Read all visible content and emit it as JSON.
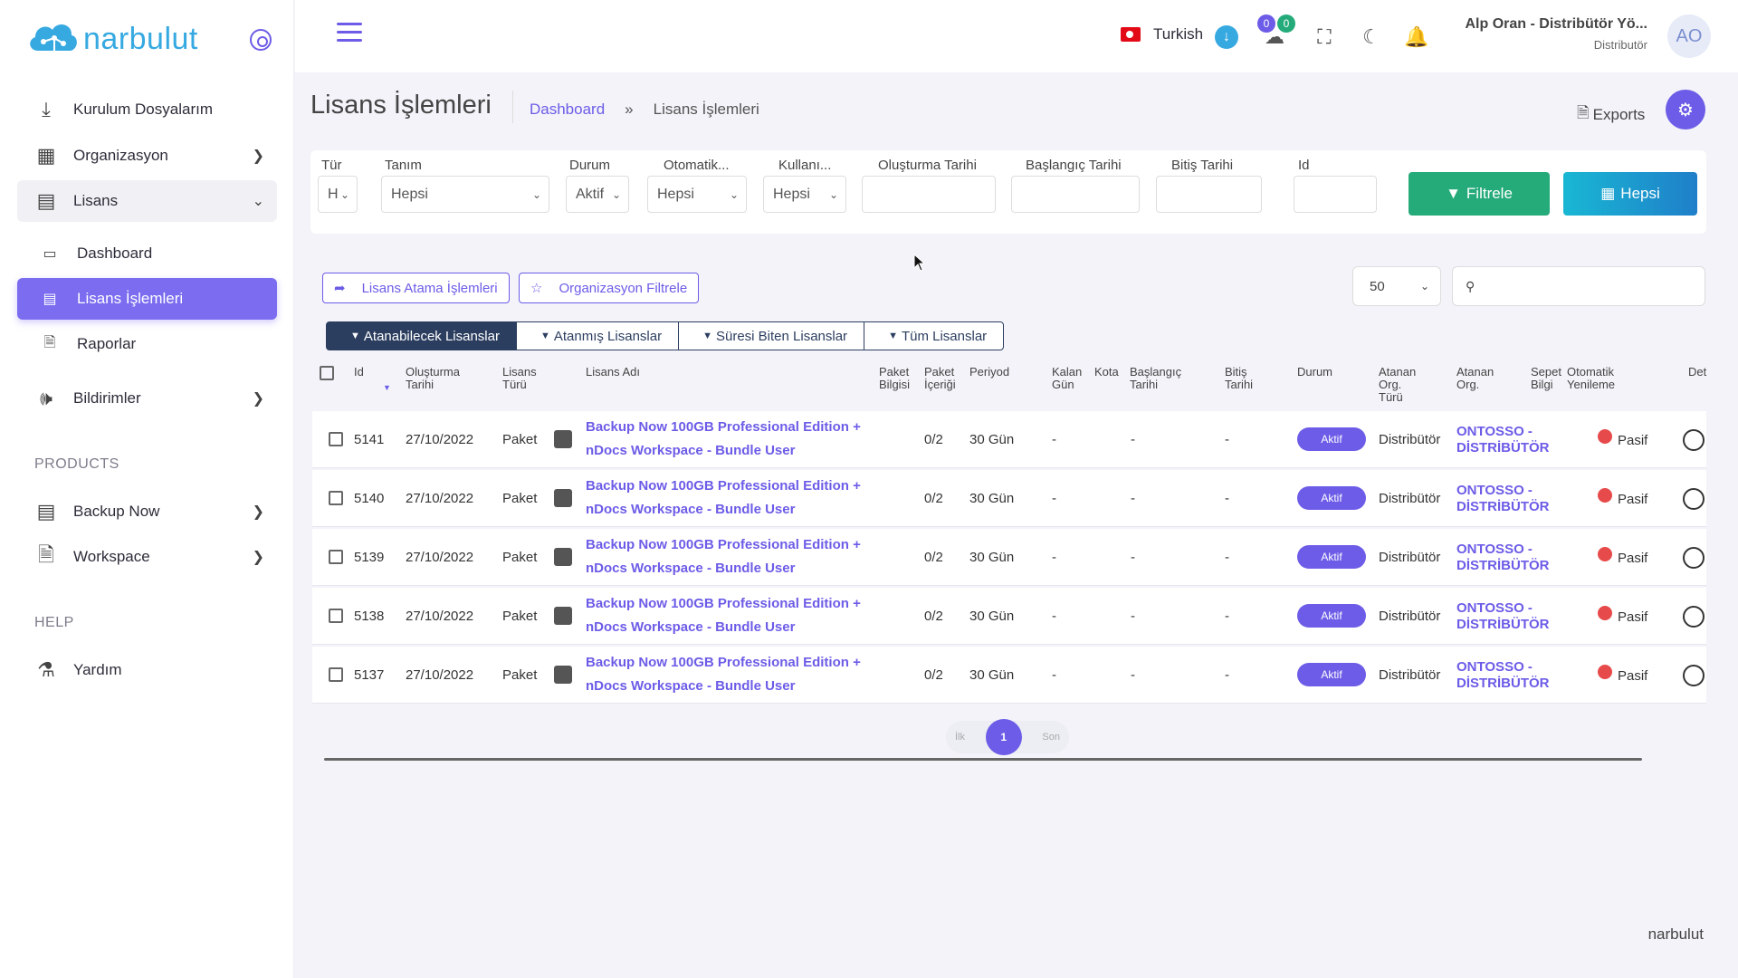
{
  "brand": {
    "name": "narbulut",
    "footer": "narbulut"
  },
  "sidebar": {
    "items": [
      {
        "label": "Kurulum Dosyalarım",
        "icon": "download-icon"
      },
      {
        "label": "Organizasyon",
        "icon": "grid-icon"
      },
      {
        "label": "Lisans",
        "icon": "id-card-icon"
      },
      {
        "label": "Dashboard",
        "icon": "monitor-icon"
      },
      {
        "label": "Lisans İşlemleri",
        "icon": "list-icon"
      },
      {
        "label": "Raporlar",
        "icon": "report-icon"
      },
      {
        "label": "Bildirimler",
        "icon": "speaker-icon"
      }
    ],
    "products_title": "PRODUCTS",
    "products": [
      {
        "label": "Backup Now",
        "icon": "server-icon"
      },
      {
        "label": "Workspace",
        "icon": "document-icon"
      }
    ],
    "help_title": "HELP",
    "help": [
      {
        "label": "Yardım",
        "icon": "flask-icon"
      }
    ]
  },
  "topbar": {
    "language": "Turkish",
    "badge_1": "0",
    "badge_2": "0",
    "user_name": "Alp Oran - Distribütör Yö...",
    "user_role": "Distributör",
    "avatar_initials": "AO"
  },
  "page": {
    "title": "Lisans İşlemleri",
    "breadcrumb_home": "Dashboard",
    "breadcrumb_sep": "»",
    "breadcrumb_current": "Lisans İşlemleri",
    "exports_label": "Exports"
  },
  "filters": {
    "tur": {
      "label": "Tür",
      "value": "H"
    },
    "tanim": {
      "label": "Tanım",
      "value": "Hepsi"
    },
    "durum": {
      "label": "Durum",
      "value": "Aktif"
    },
    "otomatik": {
      "label": "Otomatik...",
      "value": "Hepsi"
    },
    "kullanim": {
      "label": "Kullanı...",
      "value": "Hepsi"
    },
    "olusturma": {
      "label": "Oluşturma Tarihi"
    },
    "baslangic": {
      "label": "Başlangıç Tarihi"
    },
    "bitis": {
      "label": "Bitiş Tarihi"
    },
    "id": {
      "label": "Id"
    },
    "filter_button": "Filtrele",
    "all_button": "Hepsi"
  },
  "actions": {
    "assign_ops": "Lisans Atama İşlemleri",
    "org_filter": "Organizasyon Filtrele",
    "per_page": "50"
  },
  "tabs": [
    "Atanabilecek Lisanslar",
    "Atanmış Lisanslar",
    "Süresi Biten Lisanslar",
    "Tüm Lisanslar"
  ],
  "table": {
    "headers": {
      "id": "Id",
      "created_1": "Oluşturma",
      "created_2": "Tarihi",
      "type_1": "Lisans",
      "type_2": "Türü",
      "name": "Lisans Adı",
      "pkginfo_1": "Paket",
      "pkginfo_2": "Bilgisi",
      "pkgcontent_1": "Paket",
      "pkgcontent_2": "İçeriği",
      "period": "Periyod",
      "remaining_1": "Kalan",
      "remaining_2": "Gün",
      "quota": "Kota",
      "start_1": "Başlangıç",
      "start_2": "Tarihi",
      "end_1": "Bitiş",
      "end_2": "Tarihi",
      "status": "Durum",
      "orgtype_1": "Atanan",
      "orgtype_2": "Org.",
      "orgtype_3": "Türü",
      "org_1": "Atanan",
      "org_2": "Org.",
      "cart_1": "Sepet",
      "cart_2": "Bilgi",
      "auto_1": "Otomatik",
      "auto_2": "Yenileme",
      "detail": "Det"
    },
    "rows": [
      {
        "id": "5141",
        "created": "27/10/2022",
        "type": "Paket",
        "name_1": "Backup Now 100GB Professional Edition +",
        "name_2": "nDocs Workspace - Bundle User",
        "content": "0/2",
        "period": "30 Gün",
        "remaining": "-",
        "start": "-",
        "end": "-",
        "status": "Aktif",
        "org_type": "Distribütör",
        "org_1": "ONTOSSO -",
        "org_2": "DİSTRİBÜTÖR",
        "auto": "Pasif"
      },
      {
        "id": "5140",
        "created": "27/10/2022",
        "type": "Paket",
        "name_1": "Backup Now 100GB Professional Edition +",
        "name_2": "nDocs Workspace - Bundle User",
        "content": "0/2",
        "period": "30 Gün",
        "remaining": "-",
        "start": "-",
        "end": "-",
        "status": "Aktif",
        "org_type": "Distribütör",
        "org_1": "ONTOSSO -",
        "org_2": "DİSTRİBÜTÖR",
        "auto": "Pasif"
      },
      {
        "id": "5139",
        "created": "27/10/2022",
        "type": "Paket",
        "name_1": "Backup Now 100GB Professional Edition +",
        "name_2": "nDocs Workspace - Bundle User",
        "content": "0/2",
        "period": "30 Gün",
        "remaining": "-",
        "start": "-",
        "end": "-",
        "status": "Aktif",
        "org_type": "Distribütör",
        "org_1": "ONTOSSO -",
        "org_2": "DİSTRİBÜTÖR",
        "auto": "Pasif"
      },
      {
        "id": "5138",
        "created": "27/10/2022",
        "type": "Paket",
        "name_1": "Backup Now 100GB Professional Edition +",
        "name_2": "nDocs Workspace - Bundle User",
        "content": "0/2",
        "period": "30 Gün",
        "remaining": "-",
        "start": "-",
        "end": "-",
        "status": "Aktif",
        "org_type": "Distribütör",
        "org_1": "ONTOSSO -",
        "org_2": "DİSTRİBÜTÖR",
        "auto": "Pasif"
      },
      {
        "id": "5137",
        "created": "27/10/2022",
        "type": "Paket",
        "name_1": "Backup Now 100GB Professional Edition +",
        "name_2": "nDocs Workspace - Bundle User",
        "content": "0/2",
        "period": "30 Gün",
        "remaining": "-",
        "start": "-",
        "end": "-",
        "status": "Aktif",
        "org_type": "Distribütör",
        "org_1": "ONTOSSO -",
        "org_2": "DİSTRİBÜTÖR",
        "auto": "Pasif"
      }
    ]
  },
  "pagination": {
    "first": "İlk",
    "current": "1",
    "last": "Son"
  },
  "colors": {
    "accent": "#6c5ce7",
    "success": "#25ab7a",
    "info": "#1f7fc9",
    "danger": "#e74a4a"
  }
}
